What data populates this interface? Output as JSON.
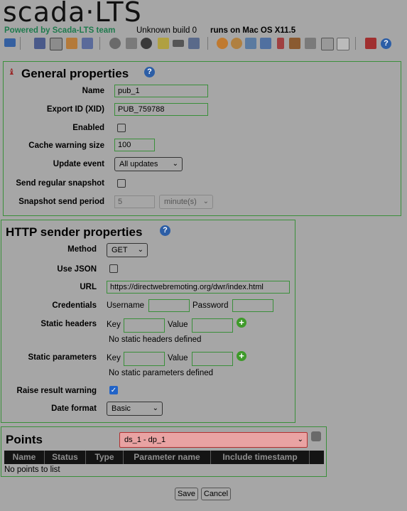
{
  "header": {
    "logo_text": "scada·LTS",
    "powered_by": "Powered by Scada-LTS team",
    "build": "Unknown build 0",
    "runs_on": "runs on Mac OS X11.5"
  },
  "toolbar": {
    "icons": [
      "watchlist-icon",
      "graphical-views-icon",
      "events-icon",
      "reports-icon",
      "data-sources-icon",
      "scheduled-events-icon",
      "compound-events-icon",
      "point-links-icon",
      "scripting-icon",
      "publishers-icon",
      "edit-tags-icon",
      "users-icon",
      "user-profiles-icon",
      "point-hierarchy-icon",
      "mailing-lists-icon",
      "publishers-2-icon",
      "maintenance-events-icon",
      "system-settings-icon",
      "emport-icon",
      "sql-icon",
      "logout-icon",
      "help-icon"
    ]
  },
  "general": {
    "title": "General properties",
    "name_label": "Name",
    "name_value": "pub_1",
    "xid_label": "Export ID (XID)",
    "xid_value": "PUB_759788",
    "enabled_label": "Enabled",
    "enabled": false,
    "cache_label": "Cache warning size",
    "cache_value": "100",
    "update_label": "Update event",
    "update_value": "All updates",
    "snapshot_label": "Send regular snapshot",
    "snapshot": false,
    "period_label": "Snapshot send period",
    "period_value": "5",
    "period_unit": "minute(s)"
  },
  "http": {
    "title": "HTTP sender properties",
    "method_label": "Method",
    "method_value": "GET",
    "json_label": "Use JSON",
    "use_json": false,
    "url_label": "URL",
    "url_value": "https://directwebremoting.org/dwr/index.html",
    "cred_label": "Credentials",
    "username_label": "Username",
    "password_label": "Password",
    "headers_label": "Static headers",
    "headers_key_label": "Key",
    "headers_value_label": "Value",
    "headers_empty": "No static headers defined",
    "params_label": "Static parameters",
    "params_key_label": "Key",
    "params_value_label": "Value",
    "params_empty": "No static parameters defined",
    "raise_label": "Raise result warning",
    "raise": true,
    "date_label": "Date format",
    "date_value": "Basic"
  },
  "points": {
    "title": "Points",
    "selected_point": "ds_1 - dp_1",
    "columns": [
      "Name",
      "Status",
      "Type",
      "Parameter name",
      "Include timestamp"
    ],
    "empty": "No points to list"
  },
  "actions": {
    "save": "Save",
    "cancel": "Cancel"
  },
  "colors": {
    "background": "#a6a6a6",
    "panel_border": "#3a8f3a",
    "brand_green": "#2e8b57",
    "select_highlight": "#e9a3a3",
    "table_header": "#141414"
  }
}
